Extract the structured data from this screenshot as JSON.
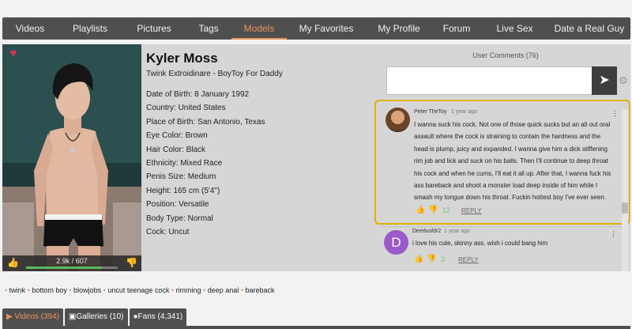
{
  "nav": {
    "items": [
      "Videos",
      "Playlists",
      "Pictures",
      "Tags",
      "Models",
      "My Favorites",
      "My Profile",
      "Forum",
      "Live Sex",
      "Date a Real Guy"
    ],
    "active_index": 4
  },
  "profile": {
    "name": "Kyler Moss",
    "tagline": "Twink Extroidinare - BoyToy For Daddy",
    "attributes": [
      "Date of Birth: 8 January 1992",
      "Country: United States",
      "Place of Birth: San Antonio, Texas",
      "Eye Color: Brown",
      "Hair Color: Black",
      "Ethnicity:  Mixed Race",
      "Penis Size: Medium",
      "Height: 165 cm (5'4\")",
      "Position: Versatile",
      "Body Type: Normal",
      "Cock: Uncut"
    ],
    "rating_text": "2.9k / 607",
    "rating_fraction": 0.83
  },
  "comments": {
    "title": "User Comments (76)",
    "items": [
      {
        "author": "Peter TheToy",
        "time": "1 year ago",
        "lines": [
          "I wanna suck his cock. Not one of those quick sucks but an all out oral",
          "assault where the cock is straining to contain the hardness and the",
          "head is plump, juicy and expanded. I wanna give him a dick stiffening",
          "rim job and lick and suck on his balls. Then I'll continue to deep throat",
          "his cock and when he cums, I'll eat it all up. After that, I wanna fuck his",
          "ass bareback and shoot a monster load deep inside of him while I",
          "smash my tongue down his throat. Fuckin hottest boy I've ever seen."
        ],
        "likes": "12",
        "reply": "REPLY"
      },
      {
        "author": "Deedusfdr2",
        "time": "1 year ago",
        "avatar_letter": "D",
        "lines": [
          "i love his cute, skinny ass. wish i could bang him"
        ],
        "likes": "3",
        "reply": "REPLY"
      }
    ]
  },
  "tags": [
    "twink",
    "bottom boy",
    "blowjobs",
    "uncut teenage cock",
    "rimming",
    "deep anal",
    "bareback"
  ],
  "tabs": [
    "Videos (394)",
    "Galleries (10)",
    "Fans (4,341)"
  ],
  "colors": {
    "accent": "#e8925a",
    "highlight": "#e2b100",
    "like": "#5cb85c"
  }
}
